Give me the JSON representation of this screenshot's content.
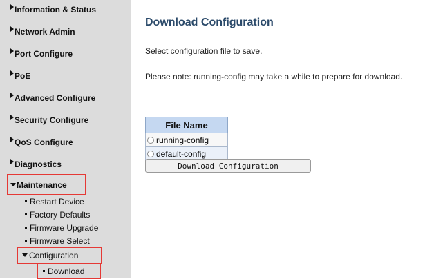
{
  "sidebar": {
    "items": [
      {
        "label": "Information & Status"
      },
      {
        "label": "Network Admin"
      },
      {
        "label": "Port Configure"
      },
      {
        "label": "PoE"
      },
      {
        "label": "Advanced Configure"
      },
      {
        "label": "Security Configure"
      },
      {
        "label": "QoS Configure"
      },
      {
        "label": "Diagnostics"
      },
      {
        "label": "Maintenance"
      }
    ],
    "maintenance_subitems": [
      {
        "label": "Restart Device"
      },
      {
        "label": "Factory Defaults"
      },
      {
        "label": "Firmware Upgrade"
      },
      {
        "label": "Firmware Select"
      },
      {
        "label": "Configuration"
      },
      {
        "label": "Download"
      }
    ]
  },
  "main": {
    "title": "Download Configuration",
    "instruction": "Select configuration file to save.",
    "note": "Please note: running-config may take a while to prepare for download.",
    "table": {
      "header": "File Name",
      "rows": [
        {
          "label": "running-config",
          "selected": false
        },
        {
          "label": "default-config",
          "selected": false
        }
      ]
    },
    "download_button_label": "Download Configuration"
  },
  "colors": {
    "sidebar_bg": "#dcdcdc",
    "title": "#2b4a6a",
    "table_header_bg": "#c5d8f1",
    "highlight_box": "#e53935"
  }
}
